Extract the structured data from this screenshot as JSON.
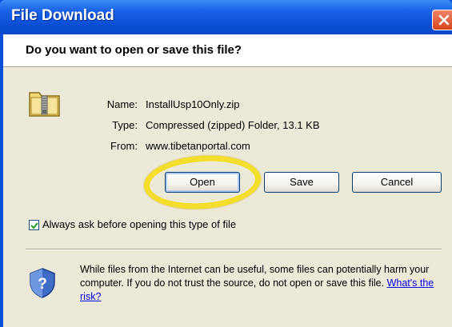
{
  "window": {
    "title": "File Download"
  },
  "dialog": {
    "question": "Do you want to open or save this file?",
    "file": {
      "name_label": "Name:",
      "name_value": "InstallUsp10Only.zip",
      "type_label": "Type:",
      "type_value": "Compressed (zipped) Folder, 13.1 KB",
      "from_label": "From:",
      "from_value": "www.tibetanportal.com"
    },
    "buttons": {
      "open": "Open",
      "save": "Save",
      "cancel": "Cancel"
    },
    "checkbox": {
      "label": "Always ask before opening this type of file",
      "checked": true
    },
    "warning": {
      "text": "While files from the Internet can be useful, some files can potentially harm your computer. If you do not trust the source, do not open or save this file. ",
      "link": "What's the risk?"
    }
  },
  "icons": {
    "close": "close-icon",
    "file": "zip-folder-icon",
    "security": "security-shield-icon",
    "check": "checkmark-icon"
  },
  "colors": {
    "titlebar": "#0a4fd9",
    "close_button": "#d9431d",
    "highlight_ring": "#f2de2b",
    "link": "#0000ee"
  }
}
